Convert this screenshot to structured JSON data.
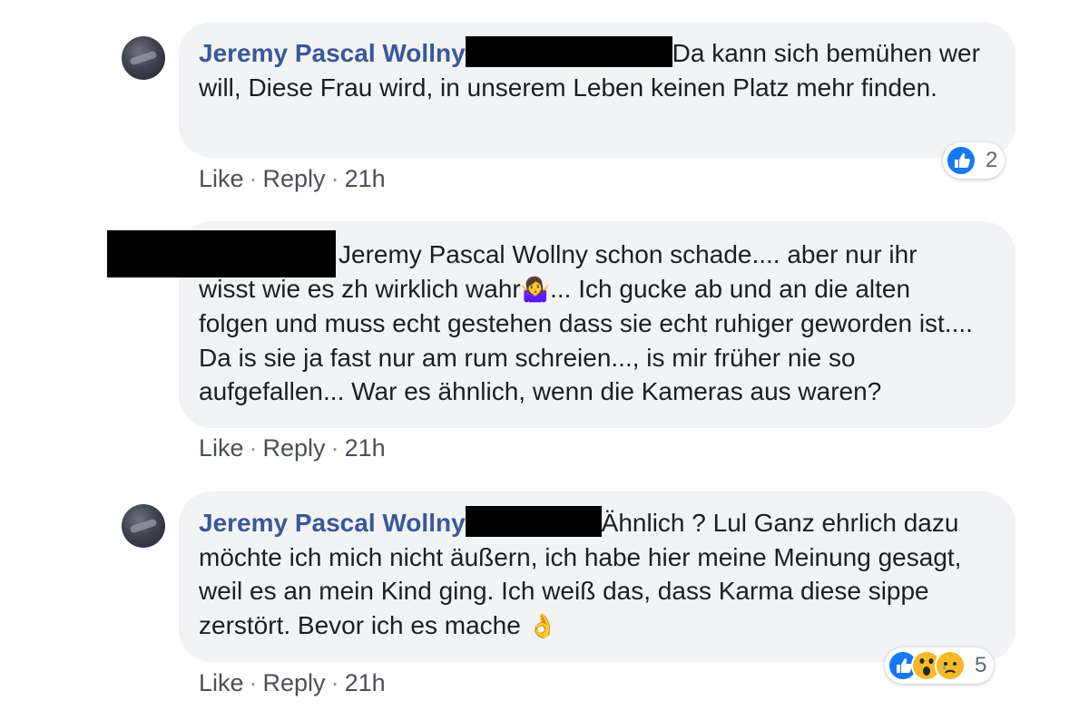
{
  "comments": [
    {
      "author": "Jeremy Pascal Wollny",
      "text": "Da kann sich bemühen wer will, Diese Frau wird, in unserem Leben keinen Platz mehr finden.",
      "actions": {
        "like": "Like",
        "reply": "Reply",
        "time": "21h"
      },
      "reactions": {
        "icons": [
          "like-icon"
        ],
        "count": "2"
      }
    },
    {
      "author_redacted": true,
      "text_line1": "Jeremy Pascal Wollny schon schade.... aber nur ihr",
      "text_line2a": "wisst wie es zh wirklich wahr",
      "emoji": "🤷‍♀️",
      "text_line2b": "... Ich gucke ab und an die alten",
      "text_rest": "folgen und muss echt gestehen dass sie echt ruhiger geworden ist.... Da is sie ja fast nur am rum schreien..., is mir früher nie so aufgefallen... War es ähnlich, wenn die Kameras aus waren?",
      "actions": {
        "like": "Like",
        "reply": "Reply",
        "time": "21h"
      }
    },
    {
      "author": "Jeremy Pascal Wollny",
      "text": "Ähnlich ? Lul Ganz ehrlich dazu möchte ich mich nicht äußern, ich habe hier meine Meinung gesagt, weil es an mein Kind ging. Ich weiß das, dass Karma diese sippe zerstört. Bevor ich es mache",
      "emoji": "👌",
      "actions": {
        "like": "Like",
        "reply": "Reply",
        "time": "21h"
      },
      "reactions": {
        "icons": [
          "like-icon",
          "wow-icon",
          "sad-icon"
        ],
        "count": "5"
      }
    }
  ],
  "colors": {
    "bubble": "#f2f3f5",
    "author": "#385898",
    "like_blue": "#1877f2",
    "emoji_yellow": "#f7b928"
  }
}
